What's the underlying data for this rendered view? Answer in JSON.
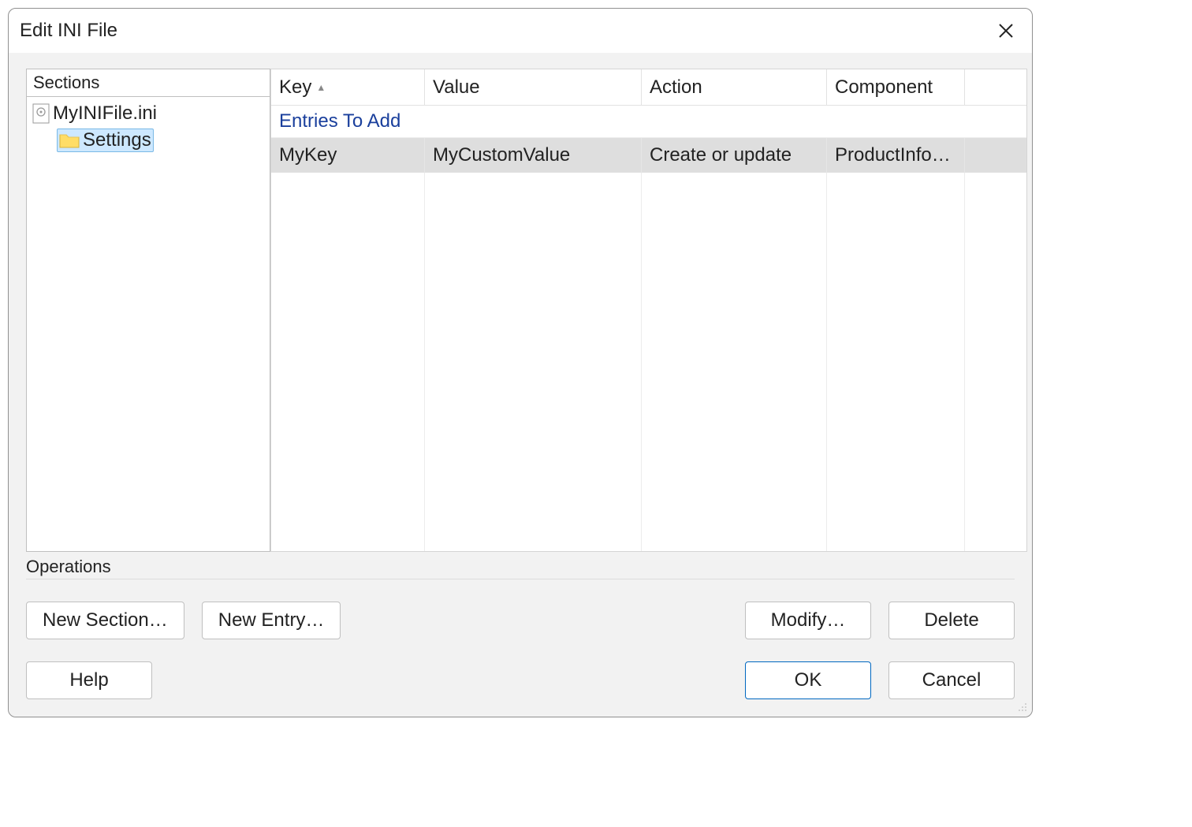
{
  "title": "Edit INI File",
  "sections": {
    "header": "Sections",
    "file_name": "MyINIFile.ini",
    "child_name": "Settings"
  },
  "grid": {
    "columns": {
      "key": "Key",
      "value": "Value",
      "action": "Action",
      "component": "Component"
    },
    "group_label": "Entries To Add",
    "rows": [
      {
        "key": "MyKey",
        "value": "MyCustomValue",
        "action": "Create or update",
        "component": "ProductInfo…"
      }
    ]
  },
  "operations": {
    "label": "Operations",
    "new_section": "New Section…",
    "new_entry": "New Entry…",
    "modify": "Modify…",
    "delete": "Delete"
  },
  "buttons": {
    "help": "Help",
    "ok": "OK",
    "cancel": "Cancel"
  }
}
